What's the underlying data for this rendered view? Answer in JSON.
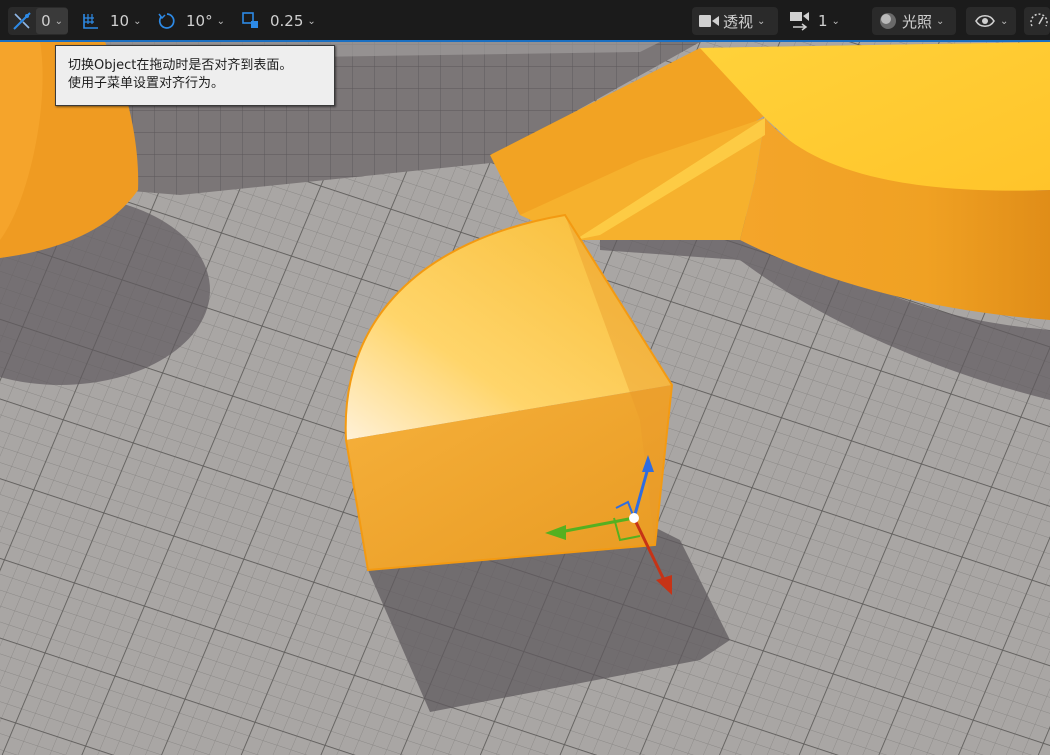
{
  "toolbar": {
    "surface_snap": {
      "icon": "surface-snap-icon",
      "value": "0"
    },
    "grid_snap": {
      "icon": "grid-snap-icon",
      "value": "10"
    },
    "rotation_snap": {
      "icon": "rotation-snap-icon",
      "value": "10°"
    },
    "scale_snap": {
      "icon": "scale-snap-icon",
      "value": "0.25"
    },
    "view_mode": {
      "icon": "camera-icon",
      "label": "透视"
    },
    "camera_speed": {
      "icon": "camera-speed-icon",
      "value": "1"
    },
    "view_lighting": {
      "icon": "lighting-sphere-icon",
      "label": "光照"
    },
    "show_flags": {
      "icon": "eye-icon"
    },
    "performance": {
      "icon": "gauge-icon"
    },
    "accent_color": "#1a6fc2"
  },
  "tooltip": {
    "line1": "切换Object在拖动时是否对齐到表面。",
    "line2": "使用子菜单设置对齐行为。"
  },
  "scene": {
    "gizmo": "translate-gizmo",
    "selected_color": "#f0a020"
  }
}
